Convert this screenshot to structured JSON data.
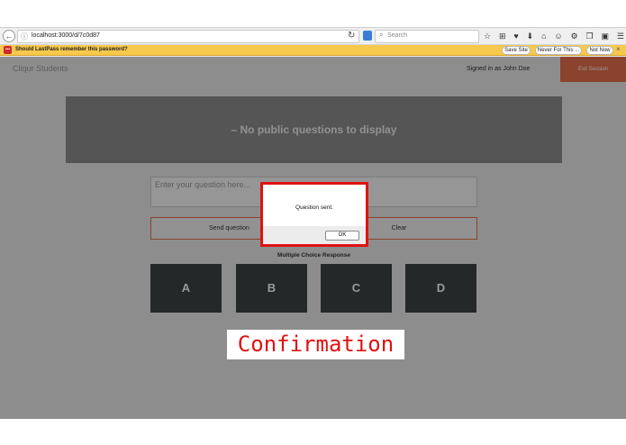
{
  "browser": {
    "url": "localhost:3000/d/7c0d87",
    "search_placeholder": "Search",
    "icons": [
      "back-icon",
      "info-icon",
      "reload-icon",
      "pinned-tab-icon",
      "search-icon",
      "star-icon",
      "reading-list-icon",
      "pocket-icon",
      "download-icon",
      "home-icon",
      "sync-icon",
      "extension-icon",
      "share-icon",
      "lastpass-icon",
      "menu-icon"
    ],
    "toolbar_glyphs": [
      "☆",
      "⊞",
      "♥",
      "⬇",
      "⌂",
      "☺",
      "⚙",
      "❒",
      "▣",
      "☰"
    ]
  },
  "lastpass": {
    "message": "Should LastPass remember this password?",
    "save_site": "Save Site",
    "never": "Never For This ...",
    "not_now": "Not Now",
    "close": "×"
  },
  "app": {
    "brand": "Cliqur Students",
    "signed_in": "Signed in as John Doe",
    "exit": "Exit Session",
    "no_questions": "– No public questions to display",
    "question_placeholder": "Enter your question here...",
    "send": "Send question",
    "clear": "Clear",
    "mcr_label": "Multiple Choice Response",
    "choices": [
      "A",
      "B",
      "C",
      "D"
    ]
  },
  "dialog": {
    "message": "Question sent.",
    "ok": "OK"
  },
  "caption": "Confirmation",
  "colors": {
    "accent": "#e8704e",
    "dialog_border": "#e01212",
    "choice_bg": "#3c4345",
    "lastpass_bar": "#f6c84c"
  }
}
